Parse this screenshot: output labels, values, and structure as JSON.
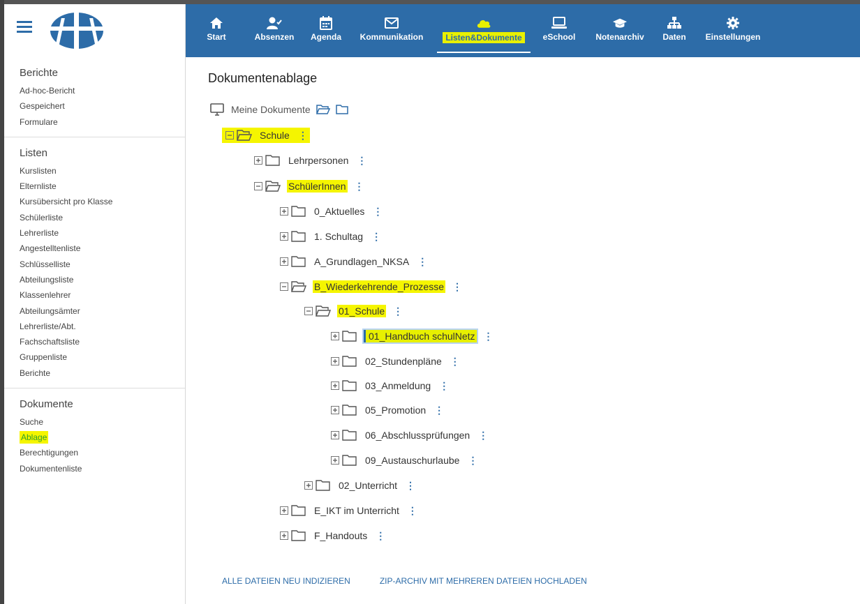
{
  "nav": {
    "items": [
      {
        "key": "start",
        "label": "Start",
        "icon": "home-icon"
      },
      {
        "key": "absenzen",
        "label": "Absenzen",
        "icon": "user-check-icon"
      },
      {
        "key": "agenda",
        "label": "Agenda",
        "icon": "calendar-icon"
      },
      {
        "key": "kommunikation",
        "label": "Kommunikation",
        "icon": "envelope-icon"
      },
      {
        "key": "listen",
        "label": "Listen&Dokumente",
        "icon": "cloud-icon"
      },
      {
        "key": "eschool",
        "label": "eSchool",
        "icon": "laptop-icon"
      },
      {
        "key": "notenarchiv",
        "label": "Notenarchiv",
        "icon": "graduation-cap-icon"
      },
      {
        "key": "daten",
        "label": "Daten",
        "icon": "sitemap-icon"
      },
      {
        "key": "einstellungen",
        "label": "Einstellungen",
        "icon": "gear-icon"
      }
    ]
  },
  "sidebar": {
    "sections": [
      {
        "heading": "Berichte",
        "links": [
          "Ad-hoc-Bericht",
          "Gespeichert",
          "Formulare"
        ]
      },
      {
        "heading": "Listen",
        "links": [
          "Kurslisten",
          "Elternliste",
          "Kursübersicht pro Klasse",
          "Schülerliste",
          "Lehrerliste",
          "Angestelltenliste",
          "Schlüsselliste",
          "Abteilungsliste",
          "Klassenlehrer",
          "Abteilungsämter",
          "Lehrerliste/Abt.",
          "Fachschaftsliste",
          "Gruppenliste",
          "Berichte"
        ]
      },
      {
        "heading": "Dokumente",
        "links": [
          "Suche",
          "Ablage",
          "Berechtigungen",
          "Dokumentenliste"
        ]
      }
    ]
  },
  "main": {
    "title": "Dokumentenablage",
    "root_label": "Meine Dokumente",
    "tree": {
      "schule": "Schule",
      "lehrpersonen": "Lehrpersonen",
      "schuelerinnen": "SchülerInnen",
      "aktuelles": "0_Aktuelles",
      "schultag": "1. Schultag",
      "grundlagen": "A_Grundlagen_NKSA",
      "prozesse": "B_Wiederkehrende_Prozesse",
      "schule01": "01_Schule",
      "handbuch": "01_Handbuch schulNetz",
      "stundenplaene": "02_Stundenpläne",
      "anmeldung": "03_Anmeldung",
      "promotion": "05_Promotion",
      "abschluss": "06_Abschlussprüfungen",
      "austausch": "09_Austauschurlaube",
      "unterricht": "02_Unterricht",
      "ikt": "E_IKT im Unterricht",
      "handouts": "F_Handouts"
    },
    "kebab": "⋮",
    "actions": {
      "reindex": "ALLE DATEIEN NEU INDIZIEREN",
      "zip_upload": "ZIP-ARCHIV MIT MEHREREN DATEIEN HOCHLADEN"
    }
  },
  "colors": {
    "header_blue": "#2d6ca8",
    "highlight_yellow": "#f5f500",
    "active_link_green": "#2ca02c"
  }
}
